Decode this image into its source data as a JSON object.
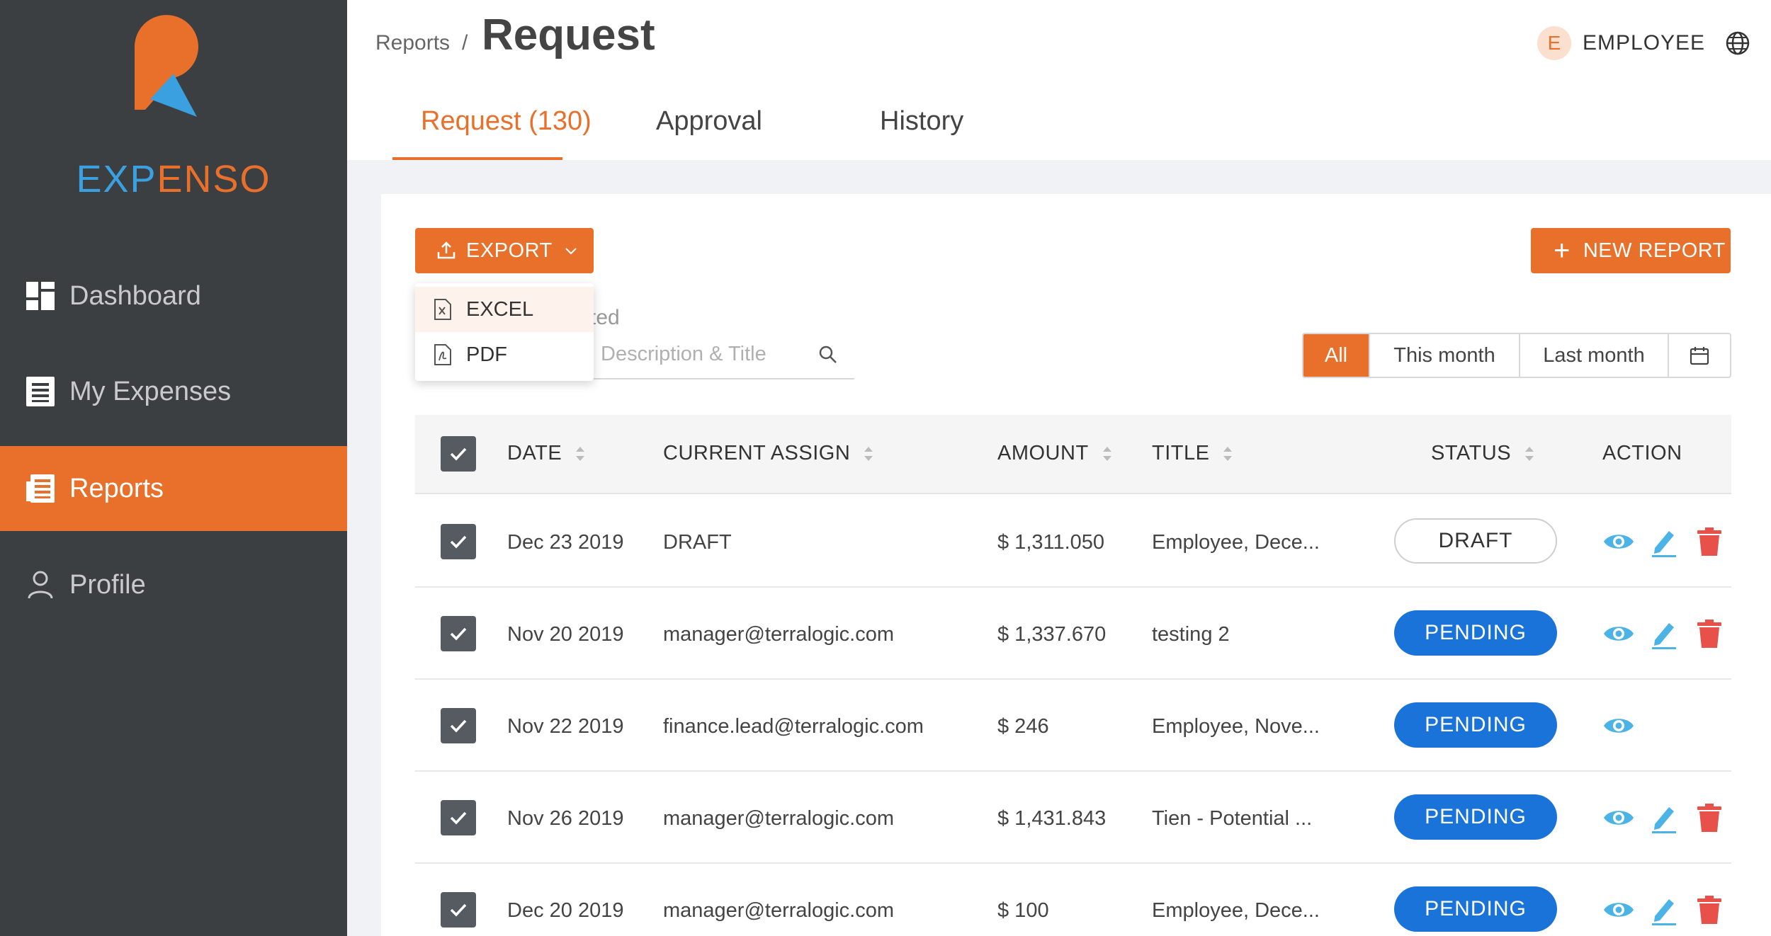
{
  "brand": {
    "part1": "EXP",
    "part2": "ENSO"
  },
  "sidebar": {
    "items": [
      {
        "label": "Dashboard",
        "icon": "dashboard-icon",
        "active": false
      },
      {
        "label": "My Expenses",
        "icon": "receipt-icon",
        "active": false
      },
      {
        "label": "Reports",
        "icon": "report-icon",
        "active": true
      },
      {
        "label": "Profile",
        "icon": "user-icon",
        "active": false
      }
    ]
  },
  "header": {
    "breadcrumb": "Reports",
    "separator": "/",
    "title": "Request",
    "avatar_letter": "E",
    "role": "EMPLOYEE"
  },
  "tabs": [
    {
      "label": "Request (130)",
      "active": true
    },
    {
      "label": "Approval",
      "active": false
    },
    {
      "label": "History",
      "active": false
    }
  ],
  "toolbar": {
    "export_label": "EXPORT",
    "new_report_label": "NEW REPORT",
    "selected_text": "cted",
    "search_placeholder": "Description & Title"
  },
  "export_menu": [
    {
      "label": "EXCEL",
      "icon": "excel-file-icon"
    },
    {
      "label": "PDF",
      "icon": "pdf-file-icon"
    }
  ],
  "filters": [
    {
      "label": "All",
      "active": true
    },
    {
      "label": "This month",
      "active": false
    },
    {
      "label": "Last month",
      "active": false
    }
  ],
  "table": {
    "columns": [
      "DATE",
      "CURRENT ASSIGN",
      "AMOUNT",
      "TITLE",
      "STATUS",
      "ACTION"
    ],
    "rows": [
      {
        "date": "Dec 23 2019",
        "assign": "DRAFT",
        "amount": "$ 1,311.050",
        "title": "Employee, Dece...",
        "status": "DRAFT",
        "editable": true
      },
      {
        "date": "Nov 20 2019",
        "assign": "manager@terralogic.com",
        "amount": "$ 1,337.670",
        "title": "testing 2",
        "status": "PENDING",
        "editable": true
      },
      {
        "date": "Nov 22 2019",
        "assign": "finance.lead@terralogic.com",
        "amount": "$ 246",
        "title": "Employee, Nove...",
        "status": "PENDING",
        "editable": false
      },
      {
        "date": "Nov 26 2019",
        "assign": "manager@terralogic.com",
        "amount": "$ 1,431.843",
        "title": "Tien - Potential ...",
        "status": "PENDING",
        "editable": true
      },
      {
        "date": "Dec 20 2019",
        "assign": "manager@terralogic.com",
        "amount": "$ 100",
        "title": "Employee, Dece...",
        "status": "PENDING",
        "editable": true
      }
    ]
  },
  "colors": {
    "accent": "#e8702a",
    "sidebar": "#3b3f42",
    "pending": "#1a73d9",
    "view": "#4bb3e6",
    "delete": "#e8504a"
  }
}
